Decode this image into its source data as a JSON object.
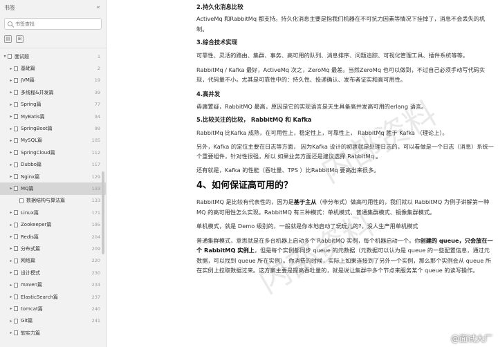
{
  "sidebar": {
    "title": "书签",
    "search_placeholder": "书签查找",
    "items": [
      {
        "label": "面试题",
        "page": "1",
        "level": "root",
        "expanded": true
      },
      {
        "label": "基础篇",
        "page": "2",
        "level": "child"
      },
      {
        "label": "JVM篇",
        "page": "19",
        "level": "child"
      },
      {
        "label": "多线程&并发篇",
        "page": "39",
        "level": "child"
      },
      {
        "label": "Spring篇",
        "page": "77",
        "level": "child"
      },
      {
        "label": "MyBatis篇",
        "page": "94",
        "level": "child"
      },
      {
        "label": "SpringBoot篇",
        "page": "99",
        "level": "child"
      },
      {
        "label": "MySQL篇",
        "page": "105",
        "level": "child"
      },
      {
        "label": "SpringCloud篇",
        "page": "112",
        "level": "child"
      },
      {
        "label": "Dubbo篇",
        "page": "117",
        "level": "child"
      },
      {
        "label": "Nginx篇",
        "page": "129",
        "level": "child"
      },
      {
        "label": "MQ篇",
        "page": "133",
        "level": "child",
        "active": true
      },
      {
        "label": "数据结构与算法篇",
        "page": "",
        "level": "sub"
      },
      {
        "label": "Linux篇",
        "page": "",
        "level": "child"
      },
      {
        "label": "Zookeeper篇",
        "page": "",
        "level": "child"
      },
      {
        "label": "Redis篇",
        "page": "",
        "level": "child"
      },
      {
        "label": "分布式篇",
        "page": "",
        "level": "child"
      },
      {
        "label": "网络篇",
        "page": "",
        "level": "child"
      },
      {
        "label": "设计模式",
        "page": "",
        "level": "child"
      },
      {
        "label": "maven篇",
        "page": "",
        "level": "child"
      },
      {
        "label": "ElasticSearch篇",
        "page": "",
        "level": "child"
      },
      {
        "label": "tomcat篇",
        "page": "",
        "level": "child"
      },
      {
        "label": "Git篇",
        "page": "",
        "level": "child"
      },
      {
        "label": "软实力篇",
        "page": "",
        "level": "child"
      }
    ],
    "side_numbers": [
      "133",
      "171",
      "195",
      "204",
      "209",
      "220",
      "230",
      "234",
      "237",
      "240",
      "241"
    ]
  },
  "content": {
    "h_persist": "2.持久化消息比较",
    "p_persist": "ActiveMq 和RabbitMq 都支持。持久化消息主要是指我们机器在不可抗力因素等情况下挂掉了，消息不会丢失的机制。",
    "h_tech": "3.综合技术实现",
    "p_tech": "可靠性、灵活的路由、集群、事务、高可用的队列、消息排序、问题追踪、可视化管理工具、插件系统等等。",
    "p_tech2": "RabbitMq / Kafka 最好，ActiveMq 次之，ZeroMq 最差。当然ZeroMq 也可以做到，不过自己必须手动写代码实现，代码量不小。尤其是可靠性中的：持久性、投递确认、发布者证实和高可用性。",
    "h_concurrency": "4.高并发",
    "p_concurrency": "毋庸置疑，RabbitMQ 最高，原因是它的实现语言是天生具备高并发高可用的erlang 语言。",
    "h_compare": "5.比较关注的比较， RabbitMQ 和 Kafka",
    "p_compare1": "RabbitMq 比Kafka 成熟，在可用性上，稳定性上，可靠性上， RabbitMq 胜于 Kafka （理论上）。",
    "p_compare2": "另外，Kafka 的定位主要在日志等方面， 因为Kafka 设计的初衷就是处理日志的，可以看做是一个日志（消息）系统一个重要组件，针对性很强，所以 如果业务方面还是建议选择 RabbitMq 。",
    "p_compare3": "还有就是，Kafka 的性能（吞吐量、TPS ）比RabbitMq 要高出来很多。",
    "h_ha": "4、如何保证高可用的？",
    "p_ha1_a": "RabbitMQ 是比较有代表性的，因为是",
    "p_ha1_b": "基于主从",
    "p_ha1_c": "（非分布式）做高可用性的，我们就以 RabbitMQ 为例子讲解第一种 MQ 的高可用性怎么实现。RabbitMQ 有三种模式：单机模式、普通集群模式、镜像集群模式。",
    "p_ha2": "单机模式，就是 Demo 级别的，一般就是你本地启动了玩玩儿的?，没人生产用单机模式",
    "p_ha3_a": "普通集群模式，意思就是在多台机器上启动多个 RabbitMQ 实例，每个机器启动一个。你",
    "p_ha3_b": "创建的 queue，只会放在一个 RabbitMQ 实例上",
    "p_ha3_c": "，但是每个实例都同步 queue 的元数据（元数据可以认为是 queue 的一些配置信息，通过元数据，可以找到 queue 所在实例）。你消费的时候，实际上如果连接到了另外一个实例，那么那个实例会从 queue 所在实例上拉取数据过来。这方案主要是提高吞吐量的，就是说让集群中多个节点来服务某个 queue 的读写操作。",
    "watermark": "内部资料",
    "brand": "@面试大厂"
  }
}
